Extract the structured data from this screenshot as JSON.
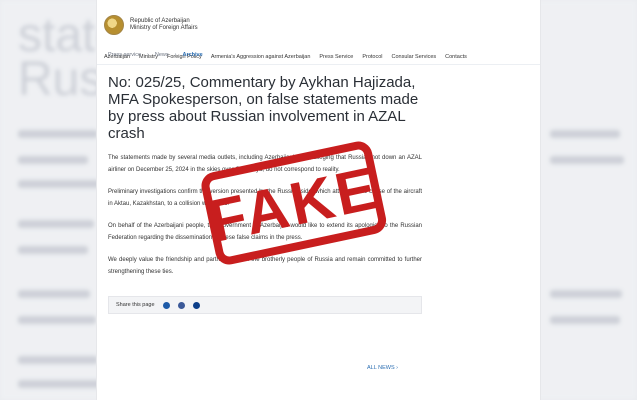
{
  "header": {
    "org_name_line1": "Republic of Azerbaijan",
    "org_name_line2": "Ministry of Foreign Affairs"
  },
  "nav": {
    "items": [
      "Azerbaijan",
      "Ministry",
      "Foreign Policy",
      "Armenia’s Aggression against Azerbaijan",
      "Press Service",
      "Protocol",
      "Consular Services",
      "Contacts"
    ]
  },
  "breadcrumb": [
    "Press service",
    "News",
    "Archive"
  ],
  "article": {
    "title": "No: 025/25, Commentary by Aykhan Hajizada, MFA Spokesperson, on false statements made by press about Russian involvement in AZAL crash",
    "paragraphs": [
      "The statements made by several media outlets, including Azerbaijani ones, alleging that Russia shot down an AZAL airliner on December 25, 2024 in the skies over Chechnya, do not correspond to reality.",
      "Preliminary investigations confirm the version presented by the Russian side, which attributes the cause of the aircraft in Aktau, Kazakhstan, to a collision with birds.",
      "On behalf of the Azerbaijani people, the Government of Azerbaijan would like to extend its apologies to the Russian Federation regarding the dissemination of these false claims in the press.",
      "We deeply value the friendship and partnership with the brotherly people of Russia and remain committed to further strengthening these ties."
    ]
  },
  "share": {
    "label": "Share this page"
  },
  "all_news": "ALL NEWS",
  "stamp": {
    "text": "FAKE",
    "color": "#c81e1e"
  },
  "background": {
    "blur_texts": [
      "statem",
      "Russia",
      "The stateme",
      "shot down a",
      "correspond t",
      "Preliminary i",
      "attributes th",
      "On behalf of",
      "to the Russia",
      "We deeply v",
      "remain commi"
    ]
  }
}
